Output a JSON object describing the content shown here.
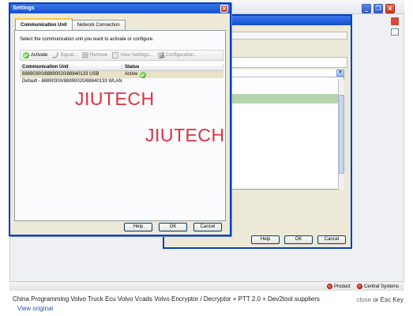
{
  "settings_dialog": {
    "title": "Settings",
    "tabs": [
      {
        "label": "Communication Unit",
        "active": true
      },
      {
        "label": "Network Connection",
        "active": false
      }
    ],
    "instruction": "Select the communication unit you want to activate or configure.",
    "toolbar": [
      {
        "label": "Activate",
        "icon": "activate-icon",
        "enabled": true
      },
      {
        "label": "Signal...",
        "icon": "signal-icon",
        "enabled": false
      },
      {
        "label": "Remove",
        "icon": "remove-icon",
        "enabled": false
      },
      {
        "label": "View Settings...",
        "icon": "view-settings-icon",
        "enabled": false
      },
      {
        "label": "Configuration...",
        "icon": "configuration-icon",
        "enabled": false
      }
    ],
    "table": {
      "columns": [
        "Communication Unit",
        "Status"
      ],
      "rows": [
        {
          "unit": "88890300/88890020/88840133 USB",
          "status": "Active",
          "selected": true
        },
        {
          "unit": "Default - 88890300/88890020/88840133 WLAN",
          "status": "",
          "selected": false
        }
      ]
    },
    "buttons": {
      "help": "Help",
      "ok": "OK",
      "cancel": "Cancel"
    }
  },
  "background_dialog": {
    "buttons": {
      "help": "Help",
      "ok": "OK",
      "cancel": "Cancel"
    }
  },
  "status_bar": {
    "items": [
      {
        "label": "Product",
        "icon": "red-dot-icon"
      },
      {
        "label": "Central Systems",
        "icon": "red-dot-icon"
      }
    ]
  },
  "watermark": [
    "JIUTECH",
    "JIUTECH"
  ],
  "caption": {
    "title": "China Programming Volvo Truck Ecu Volvo Vcads Volvo Encryptor / Decryptor + PTT 2.0 + Dev2tool suppliers",
    "view_original": "View original",
    "close_word": "close",
    "close_rest": "or Esc Key"
  },
  "colors": {
    "titlebar": "#1550d0",
    "watermark": "#e0303f",
    "selection": "#e8e3c4",
    "status_active": "#2a9a16"
  }
}
